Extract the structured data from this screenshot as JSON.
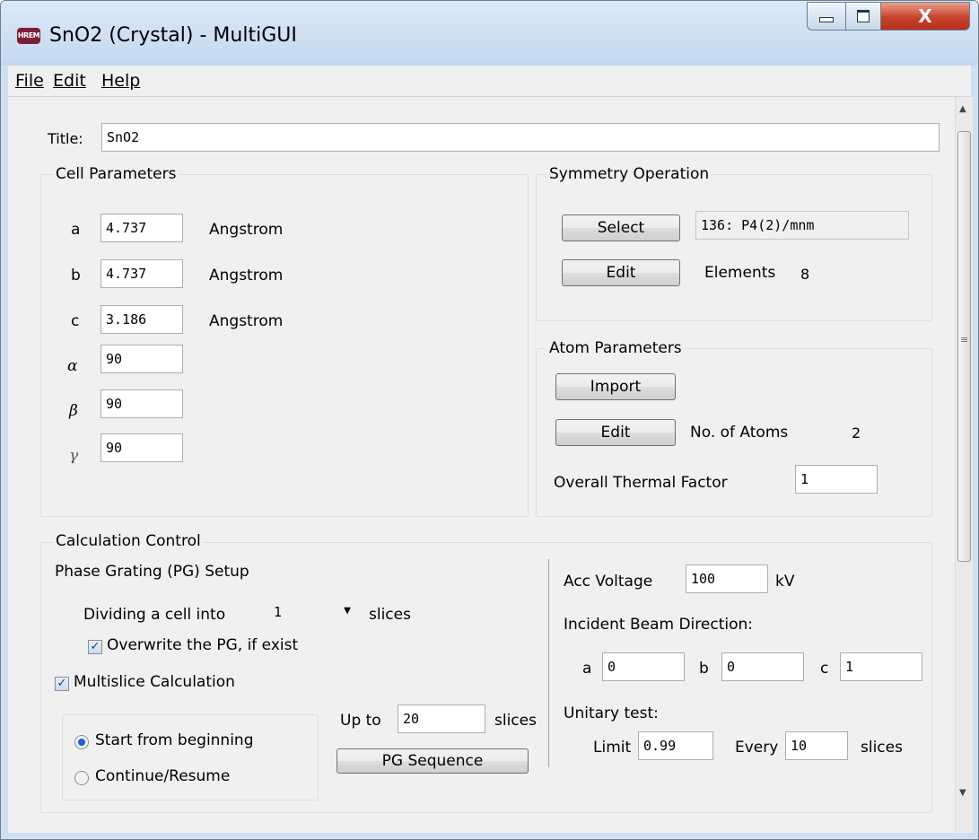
{
  "window": {
    "app_icon_text": "HREM",
    "title": "SnO2 (Crystal) - MultiGUI",
    "controls": [
      "minimize-icon",
      "maximize-icon",
      "close-icon"
    ],
    "close_glyph": "X"
  },
  "menu": {
    "file": "File",
    "edit": "Edit",
    "help": "Help"
  },
  "form": {
    "title_label": "Title:",
    "title_value": "SnO2"
  },
  "cell": {
    "group_title": "Cell Parameters",
    "unit": "Angstrom",
    "a_label": "a",
    "a_value": "4.737",
    "b_label": "b",
    "b_value": "4.737",
    "c_label": "c",
    "c_value": "3.186",
    "alpha_label": "α",
    "alpha_value": "90",
    "beta_label": "β",
    "beta_value": "90",
    "gamma_label": "γ",
    "gamma_value": "90"
  },
  "symmetry": {
    "group_title": "Symmetry Operation",
    "select_label": "Select",
    "space_group": "136: P4(2)/mnm",
    "edit_label": "Edit",
    "elements_label": "Elements",
    "elements_value": "8"
  },
  "atoms": {
    "group_title": "Atom Parameters",
    "import_label": "Import",
    "edit_label": "Edit",
    "count_label": "No. of Atoms",
    "count_value": "2",
    "thermal_label": "Overall Thermal Factor",
    "thermal_value": "1"
  },
  "calc": {
    "group_title": "Calculation Control",
    "pg_setup_label": "Phase Grating (PG) Setup",
    "dividing_label": "Dividing a cell into",
    "dividing_value": "1",
    "slices_label": "slices",
    "overwrite_label": "Overwrite the PG, if exist",
    "overwrite_checked": true,
    "multislice_label": "Multislice Calculation",
    "multislice_checked": true,
    "start_label": "Start from beginning",
    "start_selected": true,
    "continue_label": "Continue/Resume",
    "continue_selected": false,
    "upto_label": "Up to",
    "upto_value": "20",
    "upto_slices_label": "slices",
    "pg_sequence_label": "PG Sequence",
    "acc_voltage_label": "Acc Voltage",
    "acc_voltage_value": "100",
    "acc_voltage_unit": "kV",
    "beam_dir_label": "Incident Beam Direction:",
    "beam_a_label": "a",
    "beam_a_value": "0",
    "beam_b_label": "b",
    "beam_b_value": "0",
    "beam_c_label": "c",
    "beam_c_value": "1",
    "unitary_label": "Unitary test:",
    "limit_label": "Limit",
    "limit_value": "0.99",
    "every_label": "Every",
    "every_value": "10",
    "every_slices_label": "slices"
  }
}
